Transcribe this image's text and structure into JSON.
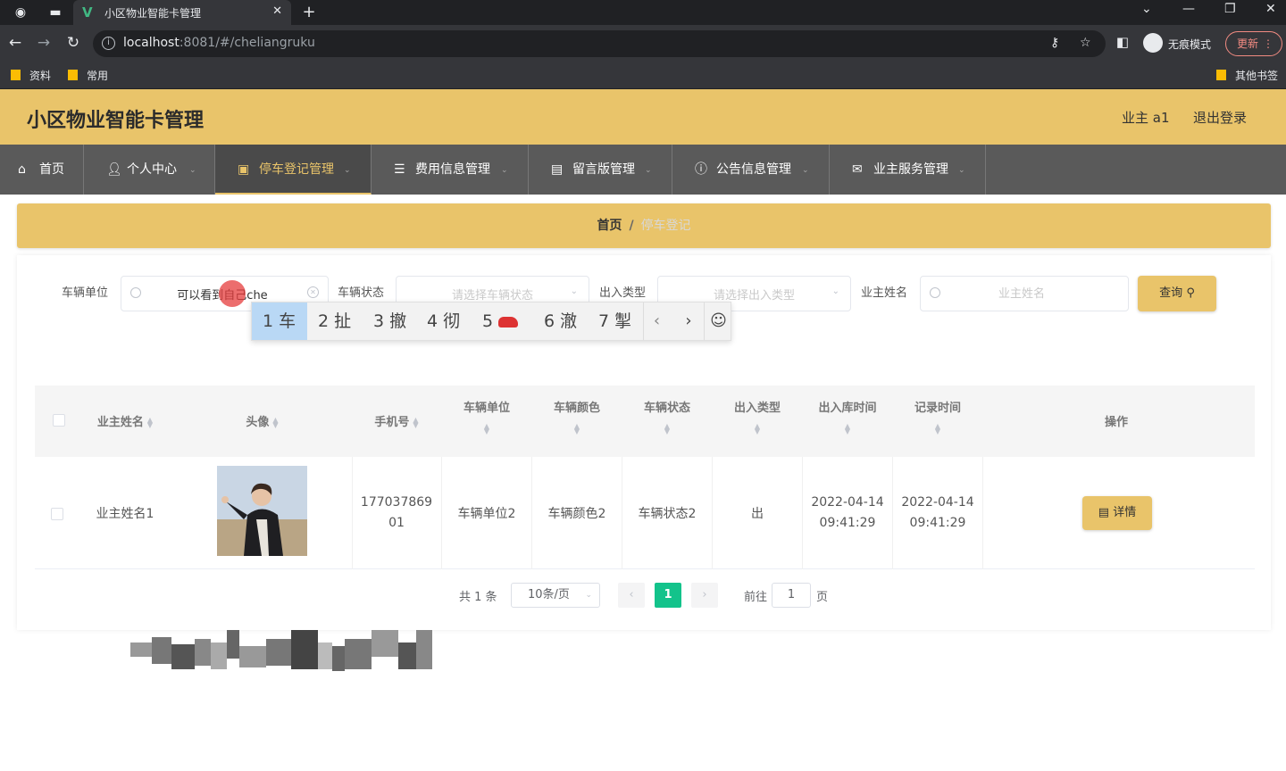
{
  "browser": {
    "tab_title": "小区物业智能卡管理",
    "url_host": "localhost",
    "url_path": ":8081/#/cheliangruku",
    "incognito_label": "无痕模式",
    "update_label": "更新",
    "bookmarks": [
      "资料",
      "常用"
    ],
    "other_bookmarks": "其他书签"
  },
  "header": {
    "title": "小区物业智能卡管理",
    "user": "业主 a1",
    "logout": "退出登录"
  },
  "menu": [
    {
      "label": "首页",
      "icon": "home-icon"
    },
    {
      "label": "个人中心",
      "icon": "user-icon"
    },
    {
      "label": "停车登记管理",
      "icon": "briefcase-icon",
      "active": true
    },
    {
      "label": "费用信息管理",
      "icon": "list-icon"
    },
    {
      "label": "留言版管理",
      "icon": "document-icon"
    },
    {
      "label": "公告信息管理",
      "icon": "info-circle-icon"
    },
    {
      "label": "业主服务管理",
      "icon": "mail-icon"
    }
  ],
  "breadcrumb": {
    "home": "首页",
    "separator": "/",
    "current": "停车登记"
  },
  "filters": {
    "vehicle_unit_label": "车辆单位",
    "vehicle_unit_value": "可以看到自己che",
    "vehicle_status_label": "车辆状态",
    "vehicle_status_placeholder": "请选择车辆状态",
    "io_type_label": "出入类型",
    "io_type_placeholder": "请选择出入类型",
    "owner_name_label": "业主姓名",
    "owner_name_placeholder": "业主姓名",
    "query_label": "查询"
  },
  "ime": {
    "candidates": [
      "1 车",
      "2 扯",
      "3 撤",
      "4 彻",
      "5",
      "6 澈",
      "7 掣"
    ]
  },
  "table": {
    "headers": {
      "owner_name": "业主姓名",
      "avatar": "头像",
      "phone": "手机号",
      "vehicle_unit": "车辆单位",
      "vehicle_color": "车辆颜色",
      "vehicle_status": "车辆状态",
      "io_type": "出入类型",
      "io_time": "出入库时间",
      "record_time": "记录时间",
      "actions": "操作"
    },
    "rows": [
      {
        "owner_name": "业主姓名1",
        "phone_line1": "177037869",
        "phone_line2": "01",
        "vehicle_unit": "车辆单位2",
        "vehicle_color": "车辆颜色2",
        "vehicle_status": "车辆状态2",
        "io_type": "出",
        "io_date": "2022-04-14",
        "io_clock": "09:41:29",
        "record_date": "2022-04-14",
        "record_clock": "09:41:29",
        "detail_label": "详情"
      }
    ]
  },
  "pagination": {
    "total": "共 1 条",
    "page_size": "10条/页",
    "current_page": "1",
    "goto_label": "前往",
    "goto_value": "1",
    "page_suffix": "页"
  },
  "colors": {
    "accent": "#e9c46a",
    "menu_bg": "#5a5a5a",
    "active_page": "#13c38b"
  }
}
